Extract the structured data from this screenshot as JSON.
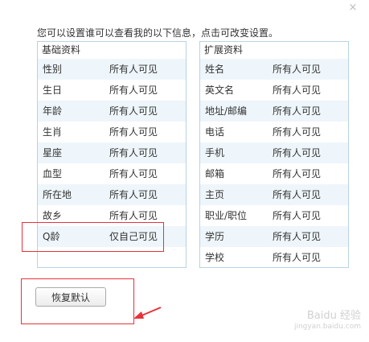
{
  "dialog": {
    "close_glyph": "×",
    "intro": "您可以设置谁可以查看我的以下信息，点击可改变设置。"
  },
  "basic": {
    "title": "基础资料",
    "rows": [
      {
        "field": "性别",
        "visibility": "所有人可见"
      },
      {
        "field": "生日",
        "visibility": "所有人可见"
      },
      {
        "field": "年龄",
        "visibility": "所有人可见"
      },
      {
        "field": "生肖",
        "visibility": "所有人可见"
      },
      {
        "field": "星座",
        "visibility": "所有人可见"
      },
      {
        "field": "血型",
        "visibility": "所有人可见"
      },
      {
        "field": "所在地",
        "visibility": "所有人可见"
      },
      {
        "field": "故乡",
        "visibility": "所有人可见"
      },
      {
        "field": "Q龄",
        "visibility": "仅自己可见"
      }
    ]
  },
  "extended": {
    "title": "扩展资料",
    "rows": [
      {
        "field": "姓名",
        "visibility": "所有人可见"
      },
      {
        "field": "英文名",
        "visibility": "所有人可见"
      },
      {
        "field": "地址/邮编",
        "visibility": "所有人可见"
      },
      {
        "field": "电话",
        "visibility": "所有人可见"
      },
      {
        "field": "手机",
        "visibility": "所有人可见"
      },
      {
        "field": "邮箱",
        "visibility": "所有人可见"
      },
      {
        "field": "主页",
        "visibility": "所有人可见"
      },
      {
        "field": "职业/职位",
        "visibility": "所有人可见"
      },
      {
        "field": "学历",
        "visibility": "所有人可见"
      },
      {
        "field": "学校",
        "visibility": "所有人可见"
      }
    ]
  },
  "footer": {
    "restore_label": "恢复默认"
  },
  "annotation_color": "#e8323b",
  "watermark": {
    "line1": "Baidu 经验",
    "line2": "jingyan.baidu.com"
  }
}
